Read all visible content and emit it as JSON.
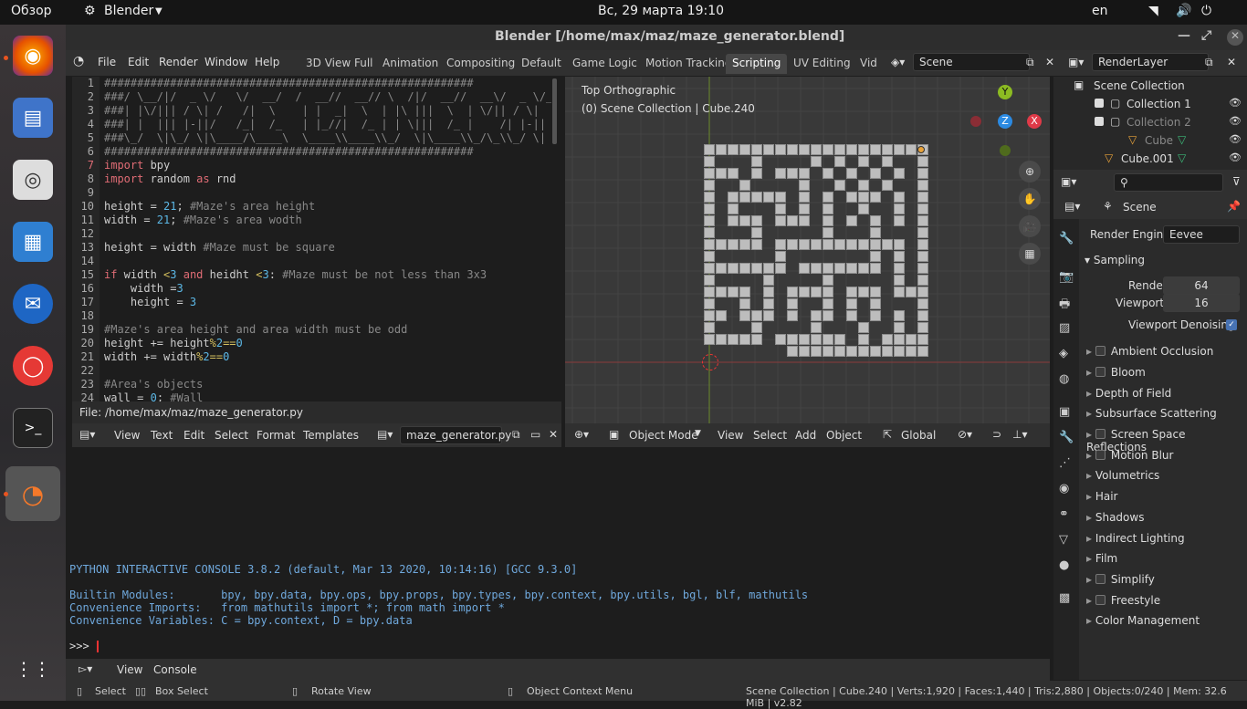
{
  "topbar": {
    "overview": "Обзор",
    "app": "Blender",
    "clock": "Вс, 29 марта  19:10",
    "lang": "en"
  },
  "window": {
    "title": "Blender [/home/max/maz/maze_generator.blend]"
  },
  "menu": {
    "file": "File",
    "edit": "Edit",
    "render": "Render",
    "window": "Window",
    "help": "Help"
  },
  "tabs": [
    "3D View Full",
    "Animation",
    "Compositing",
    "Default",
    "Game Logic",
    "Motion Tracking",
    "Scripting",
    "UV Editing",
    "Vid"
  ],
  "scene_field": "Scene",
  "renderlayer_field": "RenderLayer",
  "text_editor": {
    "lines": [
      "########################################################",
      "###/ \\__/|/  _ \\/   \\/  __/  /  __//  __// \\  /|/  __//  __\\/  _ \\/__",
      "###| |\\/||| / \\| /   /|  \\    | |  _|  \\  | |\\ |||  \\  | \\/|| / \\|  /",
      "###| |  ||| |-||/   /_|  /_   | |_//|  /_ | | \\|||  /_ |    /| |-||  |",
      "###\\_/  \\|\\_/ \\|\\____/\\____\\  \\____\\\\____\\\\_/  \\|\\____\\\\_/\\_\\\\_/ \\|  \\_/",
      "########################################################",
      "import bpy",
      "import random as rnd",
      "",
      "height = 21; #Maze's area height",
      "width = 21; #Maze's area wodth",
      "",
      "height = width #Maze must be square",
      "",
      "if width <3 and heidht <3: #Maze must be not less than 3x3",
      "    width =3",
      "    height = 3",
      "",
      "#Maze's area height and area width must be odd",
      "height += height%2==0",
      "width += width%2==0",
      "",
      "#Area's objects",
      "wall = 0; #Wall"
    ],
    "file_path": "File: /home/max/maz/maze_generator.py",
    "menu": {
      "view": "View",
      "text": "Text",
      "edit": "Edit",
      "select": "Select",
      "format": "Format",
      "templates": "Templates"
    },
    "filename": "maze_generator.py"
  },
  "viewport": {
    "view_name": "Top Orthographic",
    "collection": "(0) Scene Collection | Cube.240",
    "mode": "Object Mode",
    "menu": {
      "view": "View",
      "select": "Select",
      "add": "Add",
      "object": "Object"
    },
    "transform": "Global",
    "axes": {
      "y": "Y",
      "z": "Z",
      "x": "X"
    }
  },
  "console": {
    "line1": "PYTHON INTERACTIVE CONSOLE 3.8.2 (default, Mar 13 2020, 10:14:16)  [GCC 9.3.0]",
    "line2": "Builtin Modules:       bpy, bpy.data, bpy.ops, bpy.props, bpy.types, bpy.context, bpy.utils, bgl, blf, mathutils",
    "line3": "Convenience Imports:   from mathutils import *; from math import *",
    "line4": "Convenience Variables: C = bpy.context, D = bpy.data",
    "prompt": ">>> ",
    "menu": {
      "view": "View",
      "console": "Console"
    }
  },
  "outliner": {
    "root": "Scene Collection",
    "items": [
      "Collection 1",
      "Collection 2",
      "Cube",
      "Cube.001"
    ]
  },
  "properties": {
    "tab": "Scene",
    "render_engine_label": "Render Engine",
    "render_engine": "Eevee",
    "sampling": "Sampling",
    "render_label": "Render",
    "render_val": "64",
    "viewport_label": "Viewport",
    "viewport_val": "16",
    "denoise": "Viewport Denoising",
    "sections": [
      {
        "label": "Ambient Occlusion",
        "check": true
      },
      {
        "label": "Bloom",
        "check": true
      },
      {
        "label": "Depth of Field",
        "check": false
      },
      {
        "label": "Subsurface Scattering",
        "check": false
      },
      {
        "label": "Screen Space Reflections",
        "check": true
      },
      {
        "label": "Motion Blur",
        "check": true
      },
      {
        "label": "Volumetrics",
        "check": false
      },
      {
        "label": "Hair",
        "check": false
      },
      {
        "label": "Shadows",
        "check": false
      },
      {
        "label": "Indirect Lighting",
        "check": false
      },
      {
        "label": "Film",
        "check": false
      },
      {
        "label": "Simplify",
        "check": true
      },
      {
        "label": "Freestyle",
        "check": true
      },
      {
        "label": "Color Management",
        "check": false
      }
    ]
  },
  "status": {
    "select": "Select",
    "box": "Box Select",
    "rotate": "Rotate View",
    "context": "Object Context Menu",
    "stats": "Scene Collection | Cube.240 | Verts:1,920 | Faces:1,440 | Tris:2,880 | Objects:0/240 | Mem: 32.6 MiB | v2.82"
  },
  "maze": [
    "0000000000000000000",
    "0111011110101010110",
    "0001010001010101010",
    "0110111101101010110",
    "0100000101010001010",
    "0101110101011011010",
    "0100010001010101010",
    "0111011111011101110",
    "0000010000000000010",
    "0111110111111101010",
    "0000000100000001010",
    "0111101111011111010",
    "0000101000010001000",
    "0110101011010101110",
    "0010001010010101010",
    "0111011110111011010",
    "0000010000001010000",
    "1111111000000000000",
    "1111111111111111111"
  ]
}
